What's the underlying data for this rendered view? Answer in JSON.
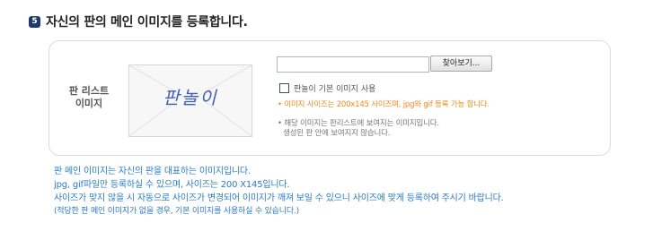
{
  "section": {
    "step": "5",
    "title": "자신의 판의 메인 이미지를 등록합니다."
  },
  "panel": {
    "label": [
      "판 리스트",
      "이미지"
    ],
    "preview_text": "판놀이",
    "browse_label": "찾아보기...",
    "file_value": "",
    "checkbox_label": "판놀이 기본 이미지 사용",
    "checkbox_checked": false,
    "note_orange": "이미지 사이즈는 200x145 사이즈며, jpg와 gif 등록 가능 합니다.",
    "note_gray": [
      "해당 이미지는 판리스트에 보여지는 이미지입니다.",
      "생성된 판 안에 보여지지 않습니다."
    ]
  },
  "info": [
    "판 메인 이미지는 자신의 판을 대표하는 이미지입니다.",
    "jpg, gif파일만 등록하실 수 있으며, 사이즈는 200 X145입니다.",
    "사이즈가 맞지 않을 시 자동으로 사이즈가 변경되어 이미지가 깨져 보일 수 있으니 사이즈에 맞게 등록하여 주시기 바랍니다.",
    "(적당한 판 메인 이미지가 없을 경우, 기본 이미지를 사용하실 수 있습니다.)"
  ],
  "colors": {
    "badge": "#1f3a6a",
    "info": "#2a7bc4",
    "note_orange": "#f28a1a",
    "preview_text": "#3f5fb8"
  }
}
